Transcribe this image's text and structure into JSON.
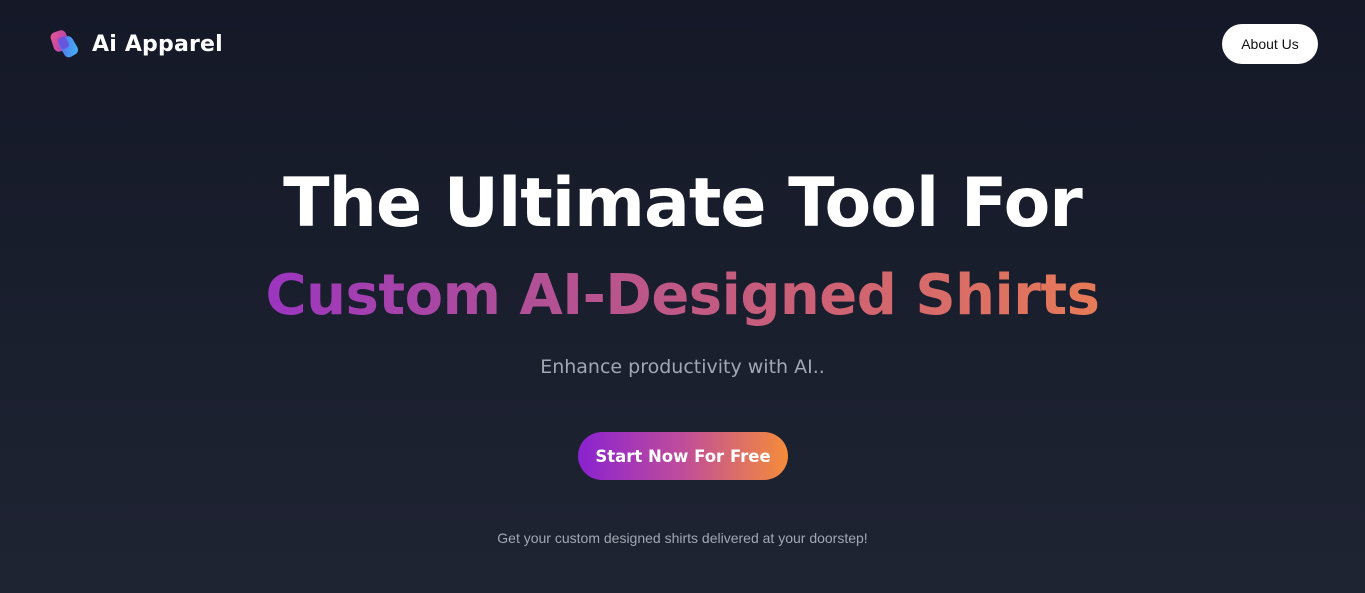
{
  "header": {
    "brand_name": "Ai Apparel",
    "logo_icon": "ai-apparel-logo-icon",
    "about_label": "About Us"
  },
  "hero": {
    "headline_line1": "The Ultimate Tool For",
    "headline_line2": "Custom AI-Designed Shirts",
    "subtitle": "Enhance productivity with AI..",
    "cta_label": "Start Now For Free",
    "footnote": "Get your custom designed shirts delivered at your doorstep!"
  },
  "colors": {
    "background_top": "#141827",
    "background_bottom": "#1f2433",
    "gradient_start": "#8a22d0",
    "gradient_mid": "#c04d9a",
    "gradient_end": "#f58c3a",
    "muted_text": "#a3a7b1"
  }
}
